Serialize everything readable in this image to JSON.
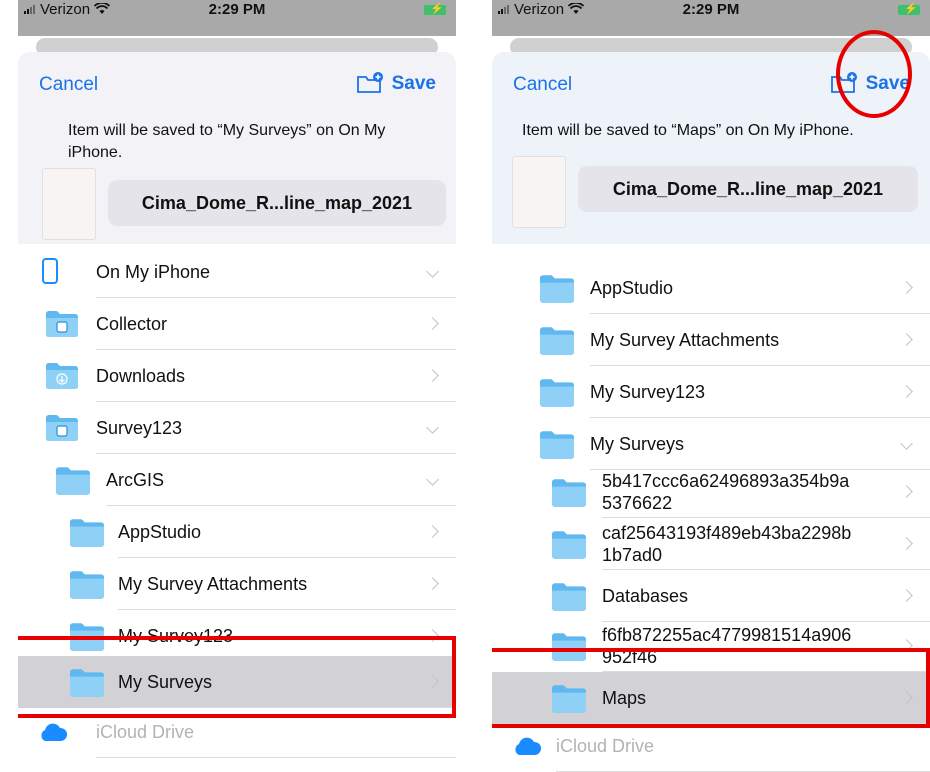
{
  "status": {
    "carrier": "Verizon",
    "time": "2:29 PM"
  },
  "header": {
    "cancel_label": "Cancel",
    "save_label": "Save",
    "new_folder_icon": "folder-plus-icon"
  },
  "accent": "#1a73e8",
  "left": {
    "save_info": "Item will be saved to “My Surveys” on On My iPhone.",
    "file_name": "Cima_Dome_R...line_map_2021",
    "items": [
      {
        "label": "On My iPhone",
        "icon": "phone-icon",
        "chevron": "down"
      },
      {
        "label": "Collector",
        "icon": "app-folder-icon",
        "chevron": "right"
      },
      {
        "label": "Downloads",
        "icon": "download-folder-icon",
        "chevron": "right"
      },
      {
        "label": "Survey123",
        "icon": "app-folder-icon",
        "chevron": "down"
      },
      {
        "label": "ArcGIS",
        "icon": "folder-icon",
        "chevron": "down"
      },
      {
        "label": "AppStudio",
        "icon": "folder-icon",
        "chevron": "right"
      },
      {
        "label": "My Survey Attachments",
        "icon": "folder-icon",
        "chevron": "right"
      },
      {
        "label": "My Survey123",
        "icon": "folder-icon",
        "chevron": "right"
      },
      {
        "label": "My Surveys",
        "icon": "folder-icon",
        "chevron": "right",
        "selected": true
      },
      {
        "label": "iCloud Drive",
        "icon": "cloud-icon",
        "chevron": "none"
      }
    ]
  },
  "right": {
    "save_info": "Item will be saved to “Maps” on On My iPhone.",
    "file_name": "Cima_Dome_R...line_map_2021",
    "items": [
      {
        "label": "AppStudio",
        "icon": "folder-icon",
        "chevron": "right"
      },
      {
        "label": "My Survey Attachments",
        "icon": "folder-icon",
        "chevron": "right"
      },
      {
        "label": "My Survey123",
        "icon": "folder-icon",
        "chevron": "right"
      },
      {
        "label": "My Surveys",
        "icon": "folder-icon",
        "chevron": "down"
      },
      {
        "label": "5b417ccc6a62496893a354b9a5376622",
        "label_lines": [
          "5b417ccc6a62496893a354b9a",
          "5376622"
        ],
        "icon": "folder-icon",
        "chevron": "right"
      },
      {
        "label": "caf25643193f489eb43ba2298b1b7ad0",
        "label_lines": [
          "caf25643193f489eb43ba2298b",
          "1b7ad0"
        ],
        "icon": "folder-icon",
        "chevron": "right"
      },
      {
        "label": "Databases",
        "icon": "folder-icon",
        "chevron": "right"
      },
      {
        "label": "f6fb872255ac4779981514a906952f46",
        "label_lines": [
          "f6fb872255ac4779981514a906",
          "952f46"
        ],
        "icon": "folder-icon",
        "chevron": "right"
      },
      {
        "label": "Maps",
        "icon": "folder-icon",
        "chevron": "right",
        "selected": true
      },
      {
        "label": "iCloud Drive",
        "icon": "cloud-icon",
        "chevron": "none"
      }
    ]
  }
}
